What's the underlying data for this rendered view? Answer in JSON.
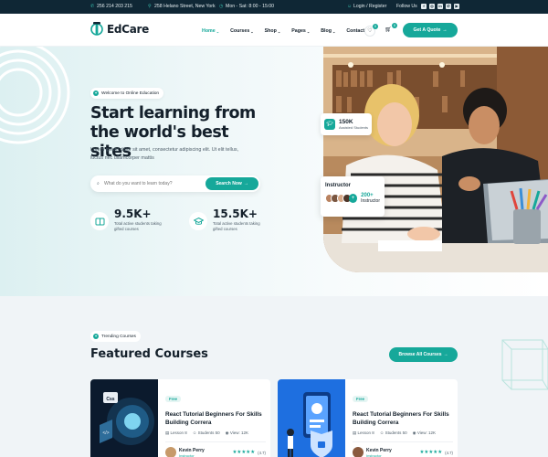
{
  "topbar": {
    "phone": "256 214 203 215",
    "address": "258 Helano Street, New York",
    "hours": "Mon - Sat: 8:00 - 15:00",
    "login": "Login / Register",
    "follow": "Follow Us",
    "social": [
      "f",
      "◎",
      "in",
      "✆",
      "▶"
    ]
  },
  "nav": {
    "brand": "EdCare",
    "menu": [
      {
        "label": "Home",
        "active": true
      },
      {
        "label": "Courses"
      },
      {
        "label": "Shop"
      },
      {
        "label": "Pages"
      },
      {
        "label": "Blog"
      },
      {
        "label": "Contact"
      }
    ],
    "wishlist_count": "0",
    "cart_count": "0",
    "quote_button": "Get A Quote"
  },
  "hero": {
    "badge": "Welcome to Online Education",
    "title": "Start learning from the world's best sites",
    "description": "Lorem ipsum dolor sit amet, consectetur adipiscing elit. Ut elit tellus, luctus nec ullamcorper mattis",
    "search_placeholder": "What do you want to learn today?",
    "search_button": "Search Now",
    "stats": [
      {
        "value": "9.5K+",
        "label": "Total active students taking gifted courses"
      },
      {
        "value": "15.5K+",
        "label": "Total active students taking gifted courses"
      }
    ],
    "students_badge": {
      "value": "150K",
      "label": "Assisted Students"
    },
    "instructor_card": {
      "title": "Instructor",
      "count": "200+",
      "label": "Instructor"
    }
  },
  "courses": {
    "badge": "Trending Courses",
    "title": "Featured Courses",
    "browse_button": "Browse All Courses",
    "items": [
      {
        "tag": "Free",
        "title": "React Tutorial Beginners For Skills Building Correra",
        "lessons": "Lesson 8",
        "students": "Students 50",
        "views": "View: 12K",
        "author": "Kevin Perry",
        "role": "Instructor",
        "rating": "(4.7)"
      },
      {
        "tag": "Free",
        "title": "React Tutorial Beginners For Skills Building Correra",
        "lessons": "Lesson 8",
        "students": "Students 50",
        "views": "View: 12K",
        "author": "Kevin Perry",
        "role": "Instructor",
        "rating": "(4.7)"
      }
    ]
  },
  "colors": {
    "accent": "#16a89a",
    "topbar": "#0f2735",
    "text": "#14202b"
  },
  "icons": [
    "phone-icon",
    "location-icon",
    "clock-icon",
    "user-icon",
    "heart-icon",
    "cart-icon",
    "search-icon",
    "arrow-right-icon",
    "star-icon"
  ]
}
